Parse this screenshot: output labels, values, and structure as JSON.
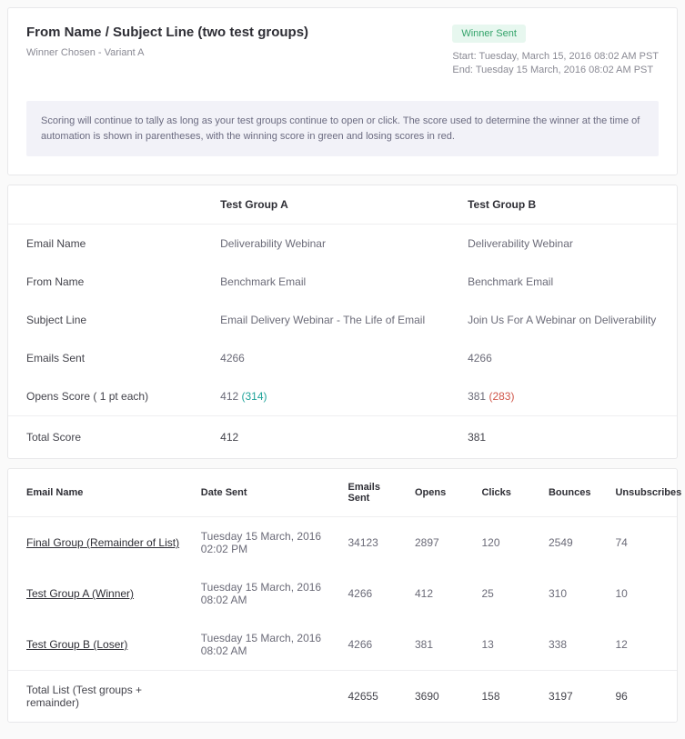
{
  "header": {
    "title": "From Name / Subject Line (two test groups)",
    "subtitle": "Winner Chosen - Variant A",
    "badge": "Winner Sent",
    "start": "Start: Tuesday, March 15, 2016 08:02 AM PST",
    "end": "End: Tuesday 15 March, 2016 08:02 AM PST",
    "info": "Scoring will continue to tally as long as your test groups continue to open or click. The score used to determine the winner at the time of automation is shown in parentheses, with the winning score in green and losing scores in red."
  },
  "compare": {
    "col_a": "Test Group A",
    "col_b": "Test Group B",
    "rows": {
      "email_name": {
        "label": "Email Name",
        "a": "Deliverability Webinar",
        "b": "Deliverability Webinar"
      },
      "from_name": {
        "label": "From Name",
        "a": "Benchmark Email",
        "b": "Benchmark Email"
      },
      "subject_line": {
        "label": "Subject Line",
        "a": "Email Delivery Webinar - The Life of Email",
        "b": "Join Us For A Webinar on Deliverability"
      },
      "emails_sent": {
        "label": "Emails Sent",
        "a": "4266",
        "b": "4266"
      },
      "opens_score": {
        "label": "Opens Score ( 1 pt each)",
        "a_main": "412",
        "a_paren": " (314)",
        "b_main": "381",
        "b_paren": " (283)"
      },
      "total_score": {
        "label": "Total Score",
        "a": "412",
        "b": "381"
      }
    }
  },
  "results": {
    "cols": [
      "Email Name",
      "Date Sent",
      "Emails Sent",
      "Opens",
      "Clicks",
      "Bounces",
      "Unsubscribes"
    ],
    "rows": [
      {
        "name": "Final Group (Remainder of List)",
        "date": "Tuesday 15 March, 2016 02:02 PM",
        "sent": "34123",
        "opens": "2897",
        "clicks": "120",
        "bounces": "2549",
        "unsub": "74"
      },
      {
        "name": "Test Group A (Winner)",
        "date": "Tuesday 15 March, 2016 08:02 AM",
        "sent": "4266",
        "opens": "412",
        "clicks": "25",
        "bounces": "310",
        "unsub": "10"
      },
      {
        "name": "Test Group B (Loser)",
        "date": "Tuesday 15 March, 2016 08:02 AM",
        "sent": "4266",
        "opens": "381",
        "clicks": "13",
        "bounces": "338",
        "unsub": "12"
      }
    ],
    "total": {
      "label": "Total List (Test groups + remainder)",
      "sent": "42655",
      "opens": "3690",
      "clicks": "158",
      "bounces": "3197",
      "unsub": "96"
    }
  }
}
